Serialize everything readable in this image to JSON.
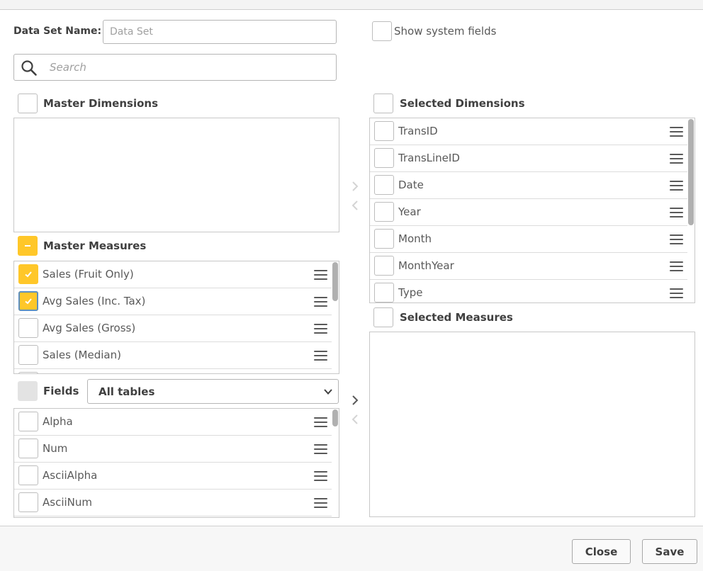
{
  "dataset": {
    "label": "Data Set Name:",
    "placeholder": "Data Set"
  },
  "system_fields": {
    "label": "Show system fields"
  },
  "search": {
    "placeholder": "Search"
  },
  "master_dimensions": {
    "title": "Master Dimensions",
    "items": []
  },
  "master_measures": {
    "title": "Master Measures",
    "items": [
      {
        "label": "Sales (Fruit Only)",
        "checked": true
      },
      {
        "label": "Avg Sales (Inc. Tax)",
        "checked": true
      },
      {
        "label": "Avg Sales (Gross)",
        "checked": false
      },
      {
        "label": "Sales (Median)",
        "checked": false
      }
    ]
  },
  "fields": {
    "title": "Fields",
    "table_select": "All tables",
    "items": [
      {
        "label": "Alpha"
      },
      {
        "label": "Num"
      },
      {
        "label": "AsciiAlpha"
      },
      {
        "label": "AsciiNum"
      }
    ]
  },
  "selected_dimensions": {
    "title": "Selected Dimensions",
    "items": [
      {
        "label": "TransID"
      },
      {
        "label": "TransLineID"
      },
      {
        "label": "Date"
      },
      {
        "label": "Year"
      },
      {
        "label": "Month"
      },
      {
        "label": "MonthYear"
      },
      {
        "label": "Type"
      }
    ]
  },
  "selected_measures": {
    "title": "Selected Measures",
    "items": []
  },
  "footer": {
    "close_label": "Close",
    "save_label": "Save"
  },
  "colors": {
    "accent": "#ffc729",
    "focus": "#5d8fc0",
    "border": "#c8c8c8",
    "text": "#404040"
  },
  "icons": {
    "search": "search-icon",
    "drag": "drag-handle-icon",
    "move_right": "chevron-right-icon",
    "move_left": "chevron-left-icon",
    "dropdown": "chevron-down-icon",
    "check": "check-icon",
    "partial": "minus-icon"
  }
}
